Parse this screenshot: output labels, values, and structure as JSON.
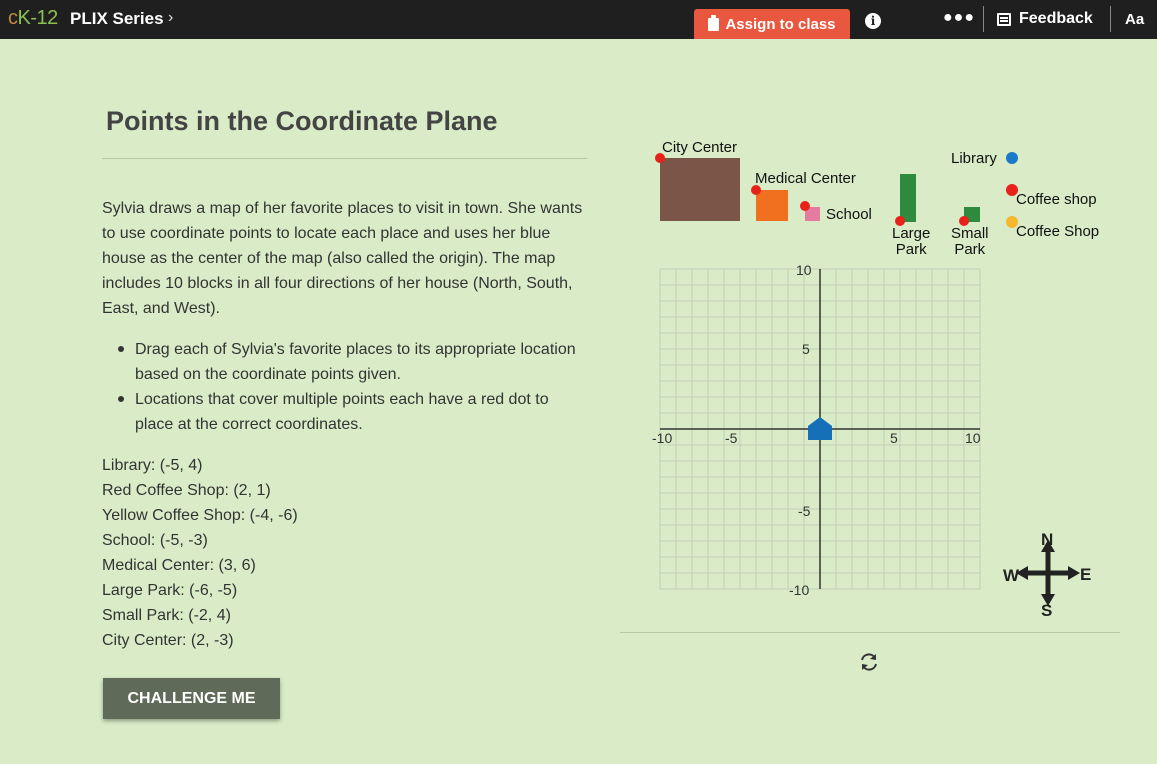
{
  "topbar": {
    "logo_c": "c",
    "logo_k": "K-12",
    "series": "PLIX Series",
    "assign_label": "Assign to class",
    "feedback_label": "Feedback",
    "font_label": "Aa",
    "accent_color": "#e9573f"
  },
  "main": {
    "title": "Points in the Coordinate Plane",
    "paragraph": "Sylvia draws a map of her favorite places to visit in town. She wants to use coordinate points to locate each place and uses her blue house as the center of the map (also called the origin). The map includes 10 blocks in all four directions of her house (North, South, East, and West).",
    "bullets": [
      "Drag each of Sylvia's favorite places to its appropriate location based on the coordinate points given.",
      "Locations that cover multiple points each have a red dot to place at the correct coordinates."
    ],
    "coords": [
      "Library: (-5, 4)",
      "Red Coffee Shop: (2, 1)",
      "Yellow Coffee Shop: (-4, -6)",
      "School: (-5, -3)",
      "Medical Center: (3, 6)",
      "Large Park: (-6, -5)",
      "Small Park: (-2, 4)",
      "City Center: (2, -3)"
    ],
    "challenge_label": "CHALLENGE ME"
  },
  "interactive": {
    "places": {
      "city_center": "City Center",
      "medical_center": "Medical Center",
      "school": "School",
      "large_park_1": "Large",
      "large_park_2": "Park",
      "small_park_1": "Small",
      "small_park_2": "Park",
      "library": "Library",
      "coffee_red": "Coffee shop",
      "coffee_yellow": "Coffee Shop"
    },
    "grid": {
      "x_ticks": [
        "-10",
        "-5",
        "5",
        "10"
      ],
      "y_ticks": [
        "10",
        "5",
        "-5",
        "-10"
      ],
      "x_min": -10,
      "x_max": 10,
      "y_min": -10,
      "y_max": 10
    },
    "compass": {
      "n": "N",
      "s": "S",
      "e": "E",
      "w": "W"
    },
    "colors": {
      "city_center": "#7a5548",
      "medical_center": "#f07020",
      "school": "#e37c9e",
      "park": "#2e8b3e",
      "library": "#1e78c8",
      "coffee_red": "#e8221b",
      "coffee_yellow": "#f5b82e",
      "house": "#1570b8"
    }
  }
}
